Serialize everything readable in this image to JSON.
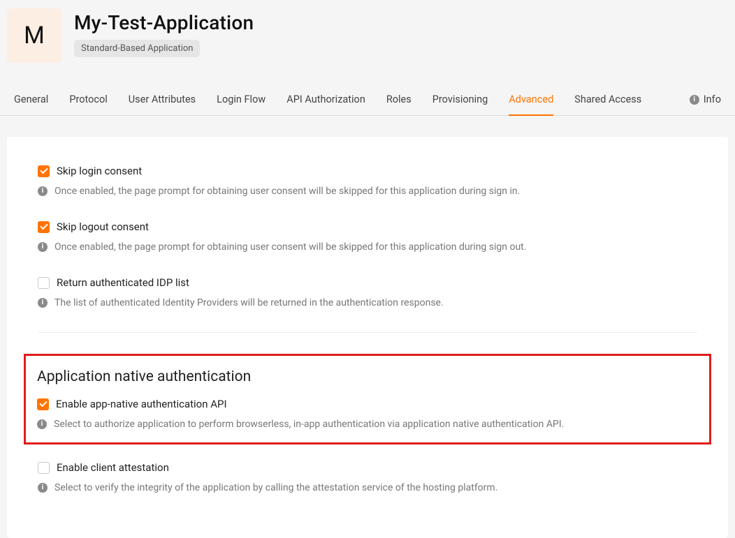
{
  "app": {
    "avatar_letter": "M",
    "title": "My-Test-Application",
    "badge": "Standard-Based Application"
  },
  "tabs": {
    "general": "General",
    "protocol": "Protocol",
    "user_attributes": "User Attributes",
    "login_flow": "Login Flow",
    "api_authorization": "API Authorization",
    "roles": "Roles",
    "provisioning": "Provisioning",
    "advanced": "Advanced",
    "shared_access": "Shared Access",
    "info": "Info"
  },
  "advanced": {
    "skip_login_consent": {
      "label": "Skip login consent",
      "hint": "Once enabled, the page prompt for obtaining user consent will be skipped for this application during sign in.",
      "checked": true
    },
    "skip_logout_consent": {
      "label": "Skip logout consent",
      "hint": "Once enabled, the page prompt for obtaining user consent will be skipped for this application during sign out.",
      "checked": true
    },
    "return_idp_list": {
      "label": "Return authenticated IDP list",
      "hint": "The list of authenticated Identity Providers will be returned in the authentication response.",
      "checked": false
    },
    "native_auth_section_title": "Application native authentication",
    "enable_app_native": {
      "label": "Enable app-native authentication API",
      "hint": "Select to authorize application to perform browserless, in-app authentication via application native authentication API.",
      "checked": true
    },
    "enable_client_attestation": {
      "label": "Enable client attestation",
      "hint": "Select to verify the integrity of the application by calling the attestation service of the hosting platform.",
      "checked": false
    }
  }
}
